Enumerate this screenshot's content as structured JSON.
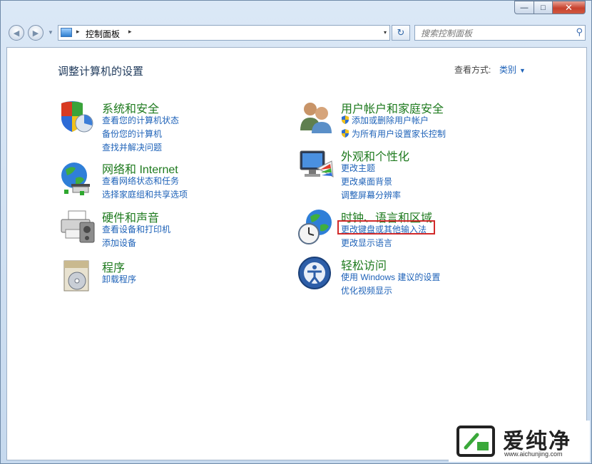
{
  "window": {
    "minimize_glyph": "—",
    "maximize_glyph": "□",
    "close_glyph": "✕"
  },
  "nav": {
    "back_icon": "back-arrow-icon",
    "forward_icon": "forward-arrow-icon",
    "address": {
      "separator": "▸",
      "breadcrumb": "控制面板",
      "separator2": "▸",
      "dropdown": "▾"
    },
    "refresh_glyph": "↻",
    "search": {
      "placeholder": "搜索控制面板",
      "icon": "search-icon",
      "glyph": "⚲"
    }
  },
  "main": {
    "title": "调整计算机的设置",
    "view_by_label": "查看方式:",
    "view_by_value": "类别",
    "view_by_arrow": "▼",
    "categories": [
      {
        "title": "系统和安全",
        "links": [
          "查看您的计算机状态",
          "备份您的计算机",
          "查找并解决问题"
        ]
      },
      {
        "title": "网络和 Internet",
        "links": [
          "查看网络状态和任务",
          "选择家庭组和共享选项"
        ]
      },
      {
        "title": "硬件和声音",
        "links": [
          "查看设备和打印机",
          "添加设备"
        ]
      },
      {
        "title": "程序",
        "links": [
          "卸载程序"
        ]
      },
      {
        "title": "用户帐户和家庭安全",
        "links": [
          "添加或删除用户帐户",
          "为所有用户设置家长控制"
        ]
      },
      {
        "title": "外观和个性化",
        "links": [
          "更改主题",
          "更改桌面背景",
          "调整屏幕分辨率"
        ]
      },
      {
        "title": "时钟、语言和区域",
        "links": [
          "更改键盘或其他输入法",
          "更改显示语言"
        ]
      },
      {
        "title": "轻松访问",
        "links": [
          "使用 Windows 建议的设置",
          "优化视频显示"
        ]
      }
    ]
  },
  "watermark": {
    "text": "爱纯净",
    "url": "www.aichunjing.com"
  },
  "colors": {
    "category_title": "#1e7a1e",
    "link": "#1e62b8",
    "highlight_border": "#d12a2a"
  }
}
